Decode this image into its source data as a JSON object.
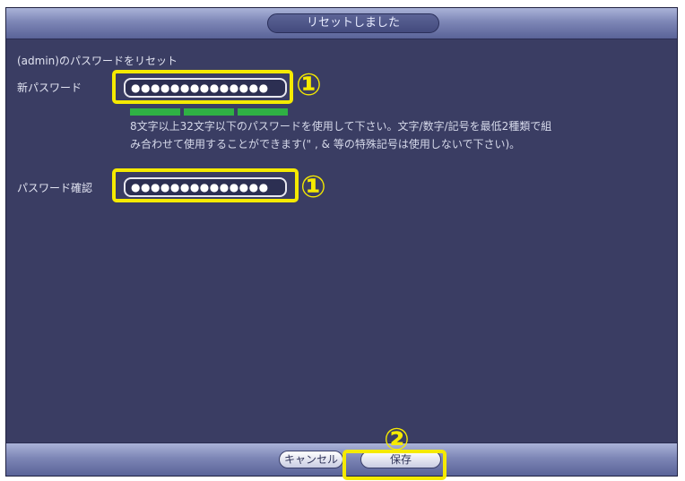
{
  "dialog": {
    "title": "リセットしました",
    "subtitle": "(admin)のパスワードをリセット",
    "new_password_label": "新パスワード",
    "new_password_value": "●●●●●●●●●●●●●●",
    "confirm_password_label": "パスワード確認",
    "confirm_password_value": "●●●●●●●●●●●●●●",
    "password_strength_level": 3,
    "hint_line1": "8文字以上32文字以下のパスワードを使用して下さい。文字/数字/記号を最低2種類で組",
    "hint_line2": "み合わせて使用することができます(\" , & 等の特殊記号は使用しないで下さい)。"
  },
  "annotations": {
    "marker1": "①",
    "marker2": "②",
    "highlight_color": "#f5ea00"
  },
  "footer": {
    "cancel_label": "キャンセル",
    "save_label": "保存"
  }
}
